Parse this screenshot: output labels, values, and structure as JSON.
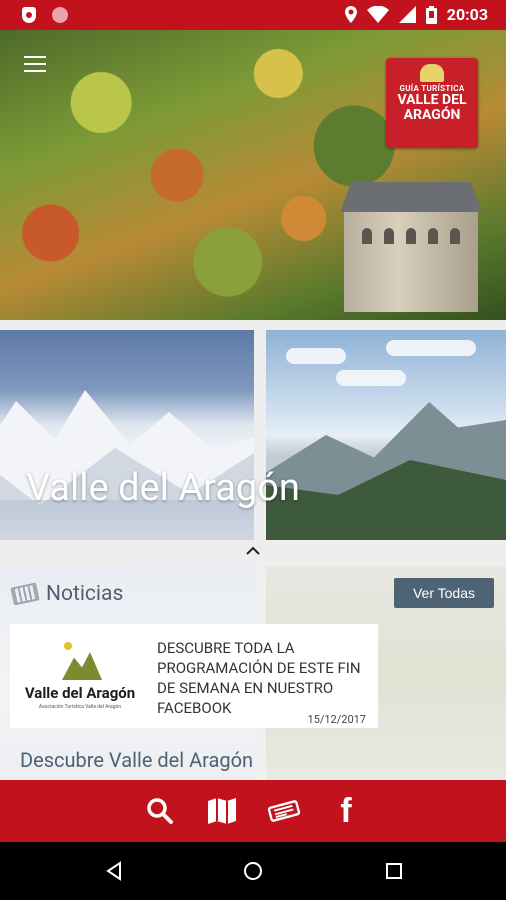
{
  "status_bar": {
    "time": "20:03"
  },
  "hero": {
    "badge_line1": "GUÍA TURÍSTICA",
    "badge_line2": "VALLE DEL",
    "badge_line3": "ARAGÓN"
  },
  "gallery": {
    "title": "Valle del Aragón"
  },
  "news": {
    "header": "Noticias",
    "ver_todas_label": "Ver Todas",
    "items": [
      {
        "logo_name": "Valle del Aragón",
        "logo_sub": "Asociación Turística Valle del Aragón",
        "text": "DESCUBRE TODA LA PROGRAMACIÓN DE ESTE FIN DE SEMANA EN NUESTRO FACEBOOK",
        "date": "15/12/2017"
      }
    ],
    "section_title": "Descubre Valle del Aragón"
  },
  "toolbar": {
    "icons": [
      "search-icon",
      "map-icon",
      "news-icon",
      "facebook-icon"
    ],
    "facebook_glyph": "f"
  },
  "colors": {
    "brand_red": "#c2121d",
    "button_slate": "#4e6474",
    "heading_slate": "#4d6274"
  }
}
